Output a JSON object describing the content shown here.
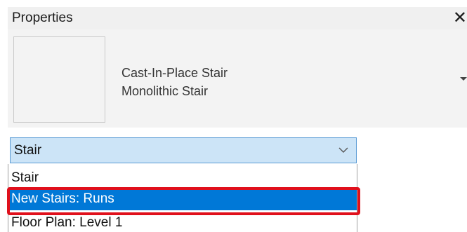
{
  "properties_panel": {
    "title": "Properties",
    "close_glyph": "✕",
    "type_selector": {
      "family": "Cast-In-Place Stair",
      "type": "Monolithic Stair",
      "arrow_icon": "caret-down-icon"
    },
    "filter_combo": {
      "selected_value": "Stair",
      "arrow_icon": "chevron-down-icon"
    },
    "filter_options": [
      {
        "label": "Stair",
        "selected": false
      },
      {
        "label": "New Stairs: Runs",
        "selected": true
      },
      {
        "label": "Floor Plan: Level 1",
        "selected": false
      }
    ],
    "colors": {
      "selection_highlight": "#0078d7",
      "annotation_box": "#e0101c",
      "combo_background": "#cce4f7"
    }
  }
}
